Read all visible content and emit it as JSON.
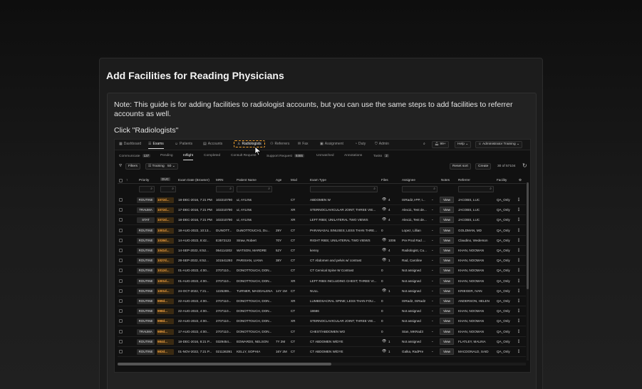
{
  "card": {
    "title": "Add Facilities for Reading Physicians",
    "note": "Note: This guide is for adding facilities to radiologist accounts, but you can use the same steps to add facilities to referrer accounts as well.",
    "instruction": "Click \"Radiologists\""
  },
  "nav": {
    "items": [
      {
        "label": "Dashboard",
        "icon": "grid-icon"
      },
      {
        "label": "Exams",
        "icon": "list-icon"
      },
      {
        "label": "Patients",
        "icon": "user-icon"
      },
      {
        "label": "Accounts",
        "icon": "building-icon"
      },
      {
        "label": "Radiologists",
        "icon": "doctor-icon"
      },
      {
        "label": "Referrers",
        "icon": "users-icon"
      },
      {
        "label": "Fax",
        "icon": "fax-icon"
      },
      {
        "label": "Assignment",
        "icon": "assignment-icon"
      },
      {
        "label": "Duty",
        "icon": "duty-icon"
      },
      {
        "label": "Admin",
        "icon": "shield-icon"
      }
    ],
    "notifications": "99+",
    "help": "Help",
    "user": "Administrator Training"
  },
  "subtabs": [
    {
      "label": "Communicate",
      "count": "137"
    },
    {
      "label": "Pending",
      "count": ""
    },
    {
      "label": "Inflight",
      "count": ""
    },
    {
      "label": "Completed",
      "count": ""
    },
    {
      "label": "Consult Request",
      "count": ""
    },
    {
      "label": "Support Request",
      "count": "8465"
    },
    {
      "label": "Unmatched",
      "count": ""
    },
    {
      "label": "Annotations",
      "count": ""
    },
    {
      "label": "Tasks",
      "count": "2"
    }
  ],
  "toolbar": {
    "filters": "Filters",
    "preset": "Training",
    "preset_count": "50",
    "reset_sort": "Reset sort",
    "create": "Create",
    "pagination": "30 of 57104"
  },
  "columns": [
    "Priority",
    "DUC",
    "Exam Date (Browser)",
    "MRN",
    "Patient Name",
    "Age",
    "Mod",
    "Exam Type",
    "Files",
    "Assignee",
    "Notes",
    "Referrer",
    "Facility"
  ],
  "view_label": "View",
  "rows": [
    {
      "priority": "ROUTINE",
      "due": "1072d...",
      "date": "18-DEC-2016, 7:21 PM",
      "mrn": "102210790",
      "patient": "ui, AYLINs",
      "age": "",
      "mod": "CT",
      "exam": "ABDOMEN W",
      "eye": true,
      "files": "4",
      "assignee": "ISRad2,I-PP, I...",
      "referrer": "JACOBS, LUC",
      "facility": "QA_Only"
    },
    {
      "priority": "TRAUMA",
      "due": "1072d...",
      "date": "17-DEC-2016, 7:21 PM",
      "mrn": "102210790",
      "patient": "ui, AYLINs",
      "age": "",
      "mod": "XR",
      "exam": "STERNOCLAVICULAR JOINT; THREE VIE...",
      "eye": true,
      "files": "4",
      "assignee": "Alex11, Test de...",
      "referrer": "JACOBS, LUC",
      "facility": "QA_Only"
    },
    {
      "priority": "STAT",
      "due": "1072d...",
      "date": "18-DEC-2016, 7:21 PM",
      "mrn": "102210790",
      "patient": "ui, AYLINs",
      "age": "",
      "mod": "XR",
      "exam": "LEFT RIBS; UNILATERAL TWO VIEWS",
      "eye": true,
      "files": "4",
      "assignee": "Alex11, Test de...",
      "referrer": "JACOBS, LUC",
      "facility": "QA_Only"
    },
    {
      "priority": "ROUTINE",
      "due": "1001d...",
      "date": "18-AUG-2022, 10:13...",
      "mrn": "DUNOTT...",
      "patient": "DuNOTTOUCH1, Du...",
      "age": "29Y",
      "mod": "CT",
      "exam": "PARANASAL SINUSES; LESS THAN THRE...",
      "eye": false,
      "files": "0",
      "assignee": "Lopez, Lillian",
      "referrer": "GOLDMAN, MD",
      "facility": "QA_Only"
    },
    {
      "priority": "ROUTINE",
      "due": "1038d...",
      "date": "14-AUG-2022, 8:42...",
      "mrn": "E3572123",
      "patient": "Straw, Robert",
      "age": "70Y",
      "mod": "CT",
      "exam": "RIGHT RIBS; UNILATERAL TWO VIEWS",
      "eye": true,
      "files": "1006",
      "assignee": "Pre Prod Rad ...",
      "referrer": "Claudino, Wederson",
      "facility": "QA_Only"
    },
    {
      "priority": "ROUTINE",
      "due": "1041d...",
      "date": "14-SEP-2022, 8:52...",
      "mrn": "064114202",
      "patient": "WATSON, MARDRE",
      "age": "52Y",
      "mod": "CT",
      "exam": "kenny",
      "eye": true,
      "files": "4",
      "assignee": "Radiologist, Cu...",
      "referrer": "KHAN, NOOMAN",
      "facility": "QA_Only"
    },
    {
      "priority": "ROUTINE",
      "due": "1027d...",
      "date": "28-SEP-2022, 8:52...",
      "mrn": "101541293",
      "patient": "PARISIAN, LIANA",
      "age": "38Y",
      "mod": "CT",
      "exam": "CT Abdomen and pelvis w/ contrast",
      "eye": true,
      "files": "1",
      "assignee": "Rad, Caroline",
      "referrer": "KHAN, NOOMAN",
      "facility": "QA_Only"
    },
    {
      "priority": "ROUTINE",
      "due": "1012d...",
      "date": "01-AUG-2022, 4:00...",
      "mrn": "2707110...",
      "patient": "DONOTTOUCH, DON...",
      "age": "",
      "mod": "CT",
      "exam": "CT Cervical Spine W Contrast",
      "eye": false,
      "files": "0",
      "assignee": "Not assigned",
      "referrer": "KHAN, NOOMAN",
      "facility": "QA_Only"
    },
    {
      "priority": "ROUTINE",
      "due": "1001d...",
      "date": "01-AUG-2022, 4:00...",
      "mrn": "2707110...",
      "patient": "DONOTTOUCH, DON...",
      "age": "",
      "mod": "XR",
      "exam": "LEFT RIBS INCLUDING CHEST; THREE VI...",
      "eye": false,
      "files": "0",
      "assignee": "Not assigned",
      "referrer": "KHAN, NOOMAN",
      "facility": "QA_Only"
    },
    {
      "priority": "ROUTINE",
      "due": "1001d...",
      "date": "24-OCT-2022, 7:21...",
      "mrn": "1225289...",
      "patient": "TURNER, MAGDALENA",
      "age": "14Y 1M",
      "mod": "CT",
      "exam": "NULL",
      "eye": true,
      "files": "1",
      "assignee": "Not assigned",
      "referrer": "KRIEGER, IVAN",
      "facility": "QA_Only"
    },
    {
      "priority": "ROUTINE",
      "due": "999d...",
      "date": "22-AUG-2022, 4:00...",
      "mrn": "2707110...",
      "patient": "DONOTTOUCH, DON...",
      "age": "",
      "mod": "XR",
      "exam": "LUMBOSACRAL SPINE; LESS THAN FOU...",
      "eye": false,
      "files": "0",
      "assignee": "ISRad2, ISRad2",
      "referrer": "ANDERSON, HELEN",
      "facility": "QA_Only"
    },
    {
      "priority": "ROUTINE",
      "due": "998d...",
      "date": "22-AUG-2022, 4:00...",
      "mrn": "2707110...",
      "patient": "DONOTTOUCH, DON...",
      "age": "",
      "mod": "CT",
      "exam": "18686",
      "eye": false,
      "files": "0",
      "assignee": "Not assigned",
      "referrer": "KHAN, NOOMAN",
      "facility": "QA_Only"
    },
    {
      "priority": "ROUTINE",
      "due": "998d...",
      "date": "22-AUG-2022, 4:00...",
      "mrn": "2707110...",
      "patient": "DONOTTOUCH, DON...",
      "age": "",
      "mod": "XR",
      "exam": "STERNOCLAVICULAR JOINT; THREE VIE...",
      "eye": false,
      "files": "0",
      "assignee": "Not assigned",
      "referrer": "KHAN, NOOMAN",
      "facility": "QA_Only"
    },
    {
      "priority": "TRAUMA",
      "due": "989d...",
      "date": "17-AUG-2022, 4:00...",
      "mrn": "2707110...",
      "patient": "DONOTTOUCH, DON...",
      "age": "",
      "mod": "CT",
      "exam": "CHEST/ABDOMEN WO",
      "eye": false,
      "files": "0",
      "assignee": "Stan, MKRad3",
      "referrer": "KHAN, NOOMAN",
      "facility": "QA_Only"
    },
    {
      "priority": "ROUTINE",
      "due": "984d...",
      "date": "18-DEC-2016, 8:21 P...",
      "mrn": "0329454...",
      "patient": "EDWARDS, NELSON",
      "age": "7Y 2M",
      "mod": "CT",
      "exam": "CT ABDOMEN W/DYE",
      "eye": true,
      "files": "1",
      "assignee": "Not assigned",
      "referrer": "FLATLEY, MALINA",
      "facility": "QA_Only"
    },
    {
      "priority": "ROUTINE",
      "due": "983d...",
      "date": "01-NOV-2022, 7:21 P...",
      "mrn": "021136391",
      "patient": "KELLY, SOPHIA",
      "age": "16Y 2M",
      "mod": "CT",
      "exam": "CT ABDOMEN W/DYE",
      "eye": true,
      "files": "1",
      "assignee": "Galka, RadPre",
      "referrer": "MACDONALD, SAID",
      "facility": "QA_Only"
    }
  ]
}
